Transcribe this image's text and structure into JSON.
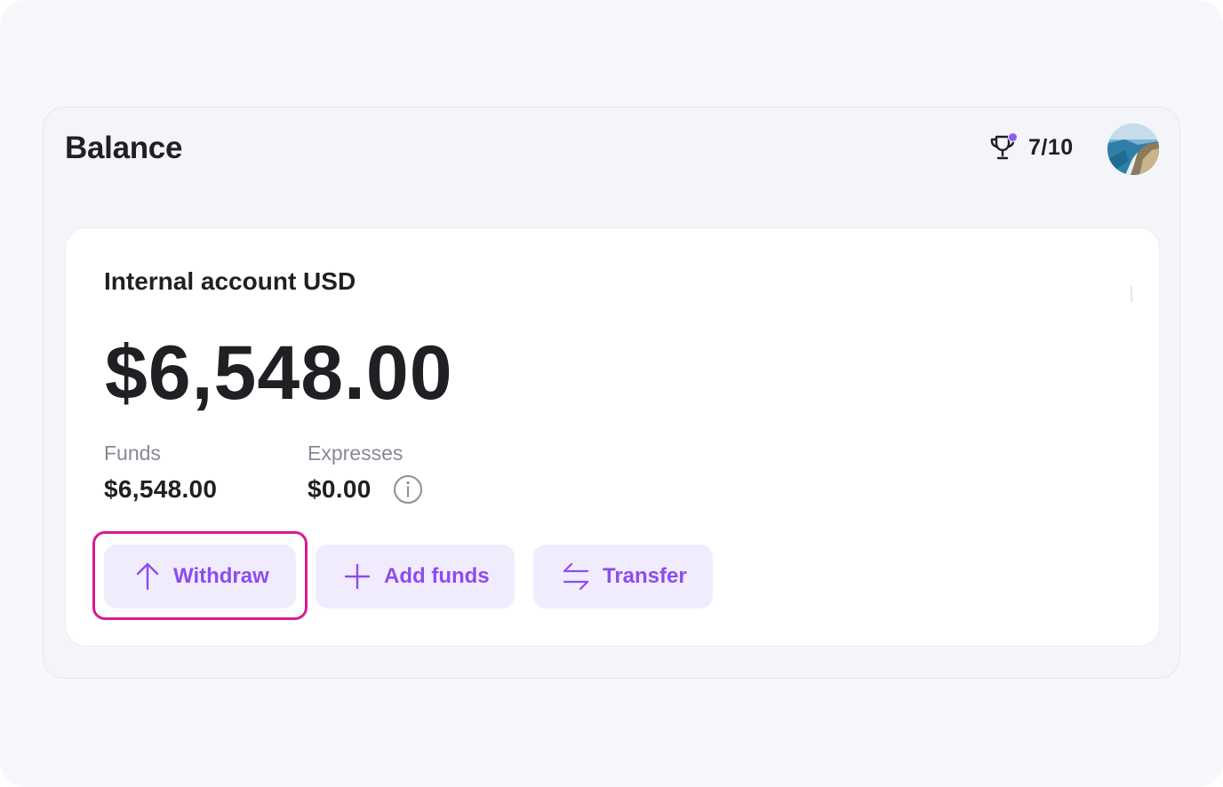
{
  "header": {
    "title": "Balance",
    "score": "7/10",
    "trophy_icon": "trophy-icon",
    "notification_color": "#8b5cf6",
    "avatar": "user-avatar"
  },
  "account": {
    "name": "Internal account USD",
    "balance": "$6,548.00",
    "funds_label": "Funds",
    "funds_value": "$6,548.00",
    "expenses_label": "Expresses",
    "expenses_value": "$0.00",
    "info_icon": "info-icon"
  },
  "actions": [
    {
      "label": "Withdraw",
      "icon": "arrow-up-icon"
    },
    {
      "label": "Add funds",
      "icon": "plus-icon"
    },
    {
      "label": "Transfer",
      "icon": "transfer-arrows-icon"
    }
  ],
  "colors": {
    "accent": "#8b4cf0",
    "button_bg": "#f1ecfd",
    "highlight": "#d81b8f"
  }
}
